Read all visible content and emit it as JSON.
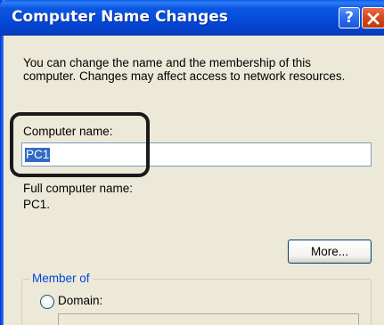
{
  "dialog": {
    "title": "Computer Name Changes",
    "help_glyph": "?",
    "intro_line1": "You can change the name and the membership of this",
    "intro_line2": "computer. Changes may affect access to network resources.",
    "computer_name_label": "Computer name:",
    "computer_name_value": "PC1",
    "full_name_label": "Full computer name:",
    "full_name_value": "PC1.",
    "more_button": "More...",
    "member_of_label": "Member of",
    "domain_label": "Domain:",
    "domain_value": ""
  },
  "colors": {
    "title_bar": "#0548d8",
    "window_bg": "#ece9d8",
    "selection": "#316ac5",
    "group_legend": "#0046d5",
    "close_button": "#d64a20"
  },
  "icons": {
    "help": "help-icon",
    "close": "close-icon"
  }
}
